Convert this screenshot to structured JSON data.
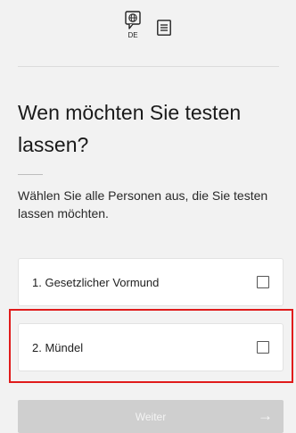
{
  "header": {
    "language_code": "DE",
    "language_icon": "speech-globe-icon",
    "menu_icon": "document-lines-icon"
  },
  "main": {
    "title": "Wen möchten Sie testen lassen?",
    "subtitle": "Wählen Sie alle Personen aus, die Sie testen lassen möchten.",
    "options": [
      {
        "label": "1. Gesetzlicher Vormund",
        "checked": false
      },
      {
        "label": "2. Mündel",
        "checked": false
      }
    ],
    "next_label": "Weiter",
    "next_icon": "arrow-right-icon"
  },
  "colors": {
    "background": "#f2f2f2",
    "card": "#ffffff",
    "disabled_button": "#cfcfcf",
    "highlight_outline": "#e01b1b"
  }
}
